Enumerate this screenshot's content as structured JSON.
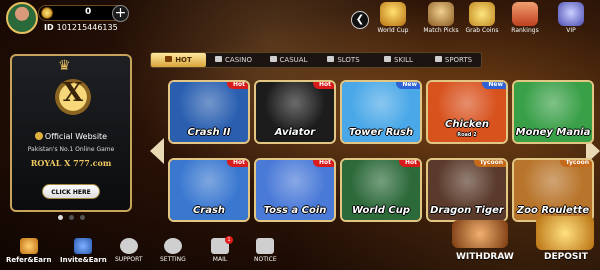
{
  "profile": {
    "coins": "0",
    "id_label": "ID",
    "id_value": "101215446135",
    "plus": "+"
  },
  "top_nav": [
    {
      "label": "World Cup",
      "icon": "trophy-icon",
      "color": "#e0a020"
    },
    {
      "label": "Match Picks",
      "icon": "ball-icon",
      "color": "#c89040"
    },
    {
      "label": "Grab Coins",
      "icon": "coins-icon",
      "color": "#e8b840"
    },
    {
      "label": "Rankings",
      "icon": "podium-icon",
      "color": "#e06a40"
    },
    {
      "label": "VIP",
      "icon": "vip-icon",
      "color": "#6a7ad8"
    }
  ],
  "banner": {
    "logo_letter": "X",
    "official": "Official Website",
    "tagline": "Pakistan's No.1 Online Game",
    "brand": "ROYAL X 777.com",
    "button": "CLICK HERE"
  },
  "tabs": [
    {
      "label": "HOT",
      "active": true
    },
    {
      "label": "CASINO"
    },
    {
      "label": "CASUAL"
    },
    {
      "label": "SLOTS"
    },
    {
      "label": "SKILL"
    },
    {
      "label": "SPORTS"
    }
  ],
  "games": [
    {
      "name": "Crash II",
      "badge": "Hot",
      "icon": "rocket-icon",
      "bg": "#2a5fb0"
    },
    {
      "name": "Aviator",
      "badge": "Hot",
      "icon": "plane-icon",
      "bg": "#1c1c1c"
    },
    {
      "name": "Tower Rush",
      "badge": "New",
      "icon": "tower-icon",
      "bg": "#4aa8e8"
    },
    {
      "name": "Chicken",
      "sub": "Road 2",
      "badge": "New",
      "icon": "chicken-icon",
      "bg": "#d8521e"
    },
    {
      "name": "Money Mania",
      "badge": "",
      "icon": "money-icon",
      "bg": "#3aa048"
    },
    {
      "name": "Crash",
      "badge": "Hot",
      "icon": "crash-plane-icon",
      "bg": "#3a78d0"
    },
    {
      "name": "Toss a Coin",
      "badge": "Hot",
      "icon": "coin-icon",
      "bg": "#4a7ad8"
    },
    {
      "name": "World Cup",
      "badge": "Hot",
      "icon": "stadium-icon",
      "bg": "#2d6a3a"
    },
    {
      "name": "Dragon Tiger",
      "badge": "Tycoon",
      "icon": "dragon-tiger-icon",
      "bg": "#5a3a2a"
    },
    {
      "name": "Zoo Roulette",
      "badge": "Tycoon",
      "icon": "lion-icon",
      "bg": "#b8742a"
    }
  ],
  "bottom_nav": [
    {
      "label": "Refer&Earn",
      "icon": "gift-icon",
      "color": "#e8a030",
      "big": true
    },
    {
      "label": "Invite&Earn",
      "icon": "invite-icon",
      "color": "#3a7ad8",
      "big": true
    },
    {
      "label": "SUPPORT",
      "icon": "support-icon",
      "color": "#cfcfcf"
    },
    {
      "label": "SETTING",
      "icon": "gear-icon",
      "color": "#cfcfcf"
    },
    {
      "label": "MAIL",
      "icon": "mail-icon",
      "color": "#cfcfcf",
      "dot": "1"
    },
    {
      "label": "NOTICE",
      "icon": "notice-icon",
      "color": "#cfcfcf"
    }
  ],
  "withdraw": "WITHDRAW",
  "deposit": "DEPOSIT"
}
